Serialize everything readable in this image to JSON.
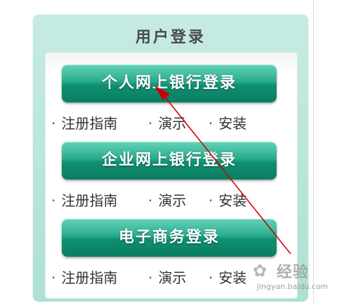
{
  "panel": {
    "title": "用户登录",
    "colors": {
      "panel_bg": "#b9e5da",
      "button": "#1a9a7b",
      "arrow": "#cc0000"
    }
  },
  "logins": [
    {
      "label": "个人网上银行登录",
      "links": [
        {
          "dot": "·",
          "text": "注册指南"
        },
        {
          "dot": "·",
          "text": "演示"
        },
        {
          "dot": "·",
          "text": "安装"
        }
      ]
    },
    {
      "label": "企业网上银行登录",
      "links": [
        {
          "dot": "·",
          "text": "注册指南"
        },
        {
          "dot": "·",
          "text": "演示"
        },
        {
          "dot": "·",
          "text": "安装"
        }
      ]
    },
    {
      "label": "电子商务登录",
      "links": [
        {
          "dot": "·",
          "text": "注册指南"
        },
        {
          "dot": "·",
          "text": "演示"
        },
        {
          "dot": "·",
          "text": "安装"
        }
      ]
    }
  ],
  "watermark": {
    "logo": "经验",
    "url": "jingyan.baidu.com"
  }
}
